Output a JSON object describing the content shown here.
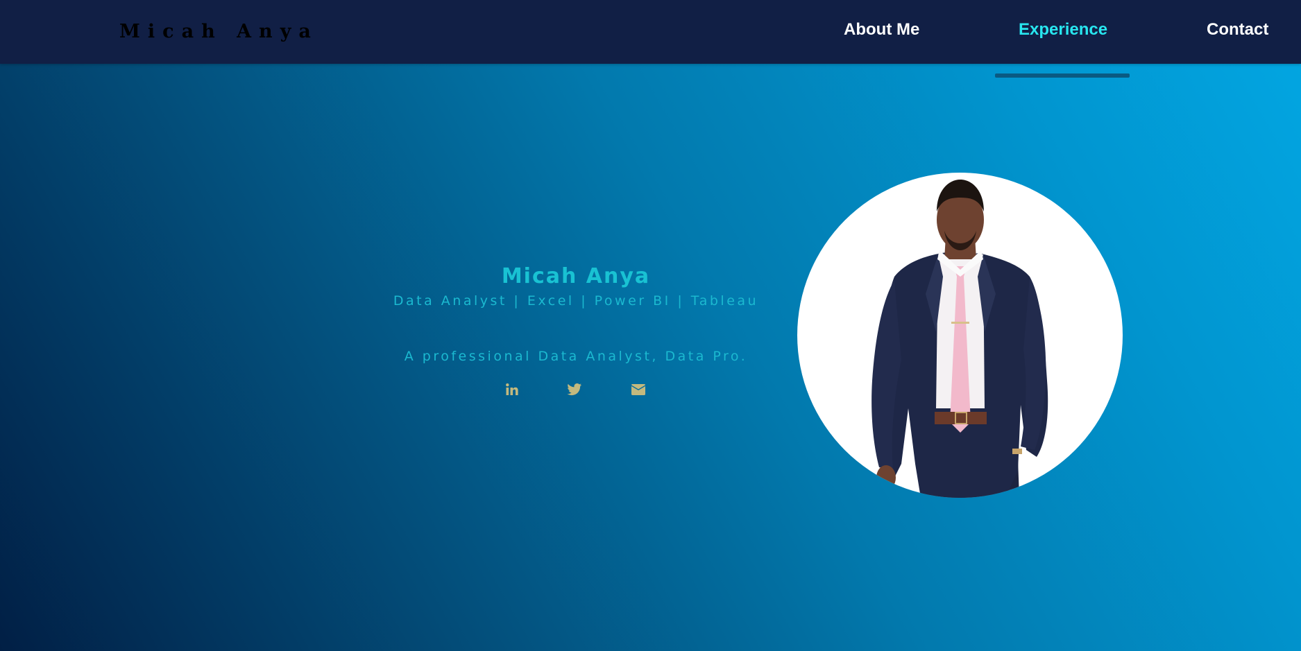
{
  "header": {
    "brand": "Micah Anya",
    "nav": [
      {
        "label": "About Me",
        "active": false
      },
      {
        "label": "Experience",
        "active": true
      },
      {
        "label": "Contact",
        "active": false
      }
    ]
  },
  "hero": {
    "name": "Micah Anya",
    "tagline": "Data Analyst | Excel | Power BI | Tableau",
    "description": "A professional Data Analyst, Data Pro.",
    "socials": [
      {
        "icon": "linkedin-icon"
      },
      {
        "icon": "twitter-icon"
      },
      {
        "icon": "email-icon"
      }
    ],
    "photo": {
      "icon": "profile-photo"
    }
  },
  "colors": {
    "nav_background": "#111f45",
    "nav_active": "#28e6ef",
    "hero_text": "#19c2d3",
    "social_icon": "#c3b97e",
    "gradient_start": "#011f45",
    "gradient_end": "#02a7e3"
  }
}
